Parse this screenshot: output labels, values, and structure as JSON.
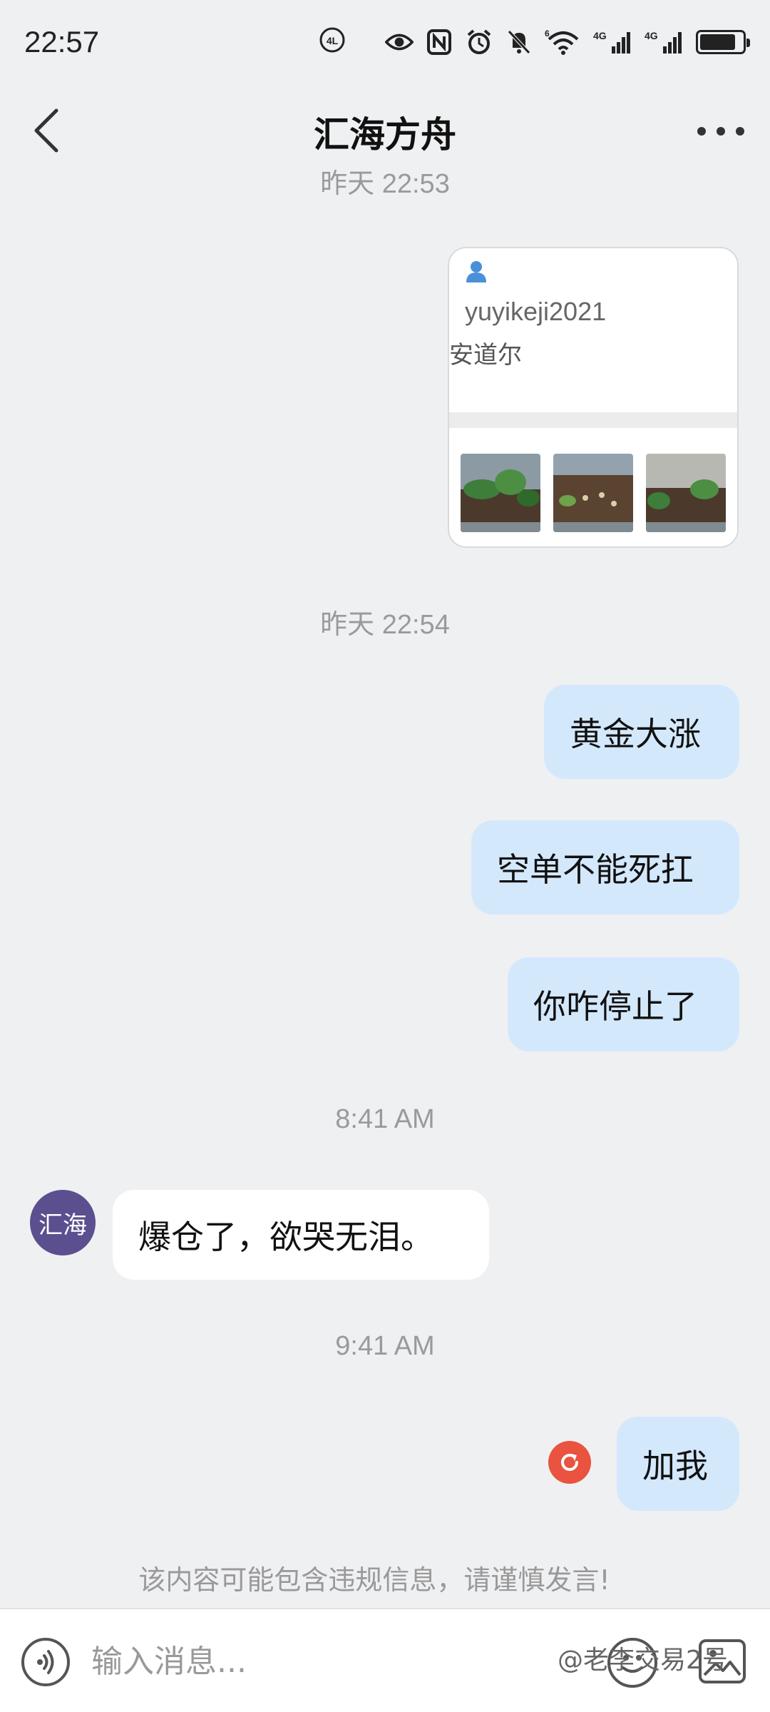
{
  "status_bar": {
    "time": "22:57",
    "signal_1_label": "4G",
    "signal_2_label": "4G",
    "wifi_label": "6",
    "battery_level": 0.85,
    "icons": [
      "hd-icon",
      "eye-icon",
      "nfc-icon",
      "alarm-icon",
      "mute-icon",
      "wifi-icon",
      "signal-icon",
      "signal-icon",
      "battery-icon"
    ]
  },
  "nav": {
    "title": "汇海方舟"
  },
  "chat": {
    "timestamp_top": "昨天 22:53",
    "card": {
      "username": "yuyikeji2021",
      "description": "安道尔"
    },
    "timestamp_1": "昨天 22:54",
    "msg_1": "黄金大涨",
    "msg_2": "空单不能死扛",
    "msg_3": "你咋停止了",
    "timestamp_2": "8:41 AM",
    "contact_avatar": "汇海",
    "reply_1": "爆仓了，欲哭无泪。",
    "timestamp_3": "9:41 AM",
    "msg_4": "加我",
    "warning": "该内容可能包含违规信息，请谨慎发言!"
  },
  "input": {
    "placeholder": "输入消息..."
  },
  "watermark": "@老李交易2号",
  "colors": {
    "my_bubble": "#d4e8fc",
    "their_bubble": "#ffffff",
    "avatar_bg": "#5b4f8f",
    "retry_red": "#e9533f",
    "background": "#eff0f2"
  }
}
